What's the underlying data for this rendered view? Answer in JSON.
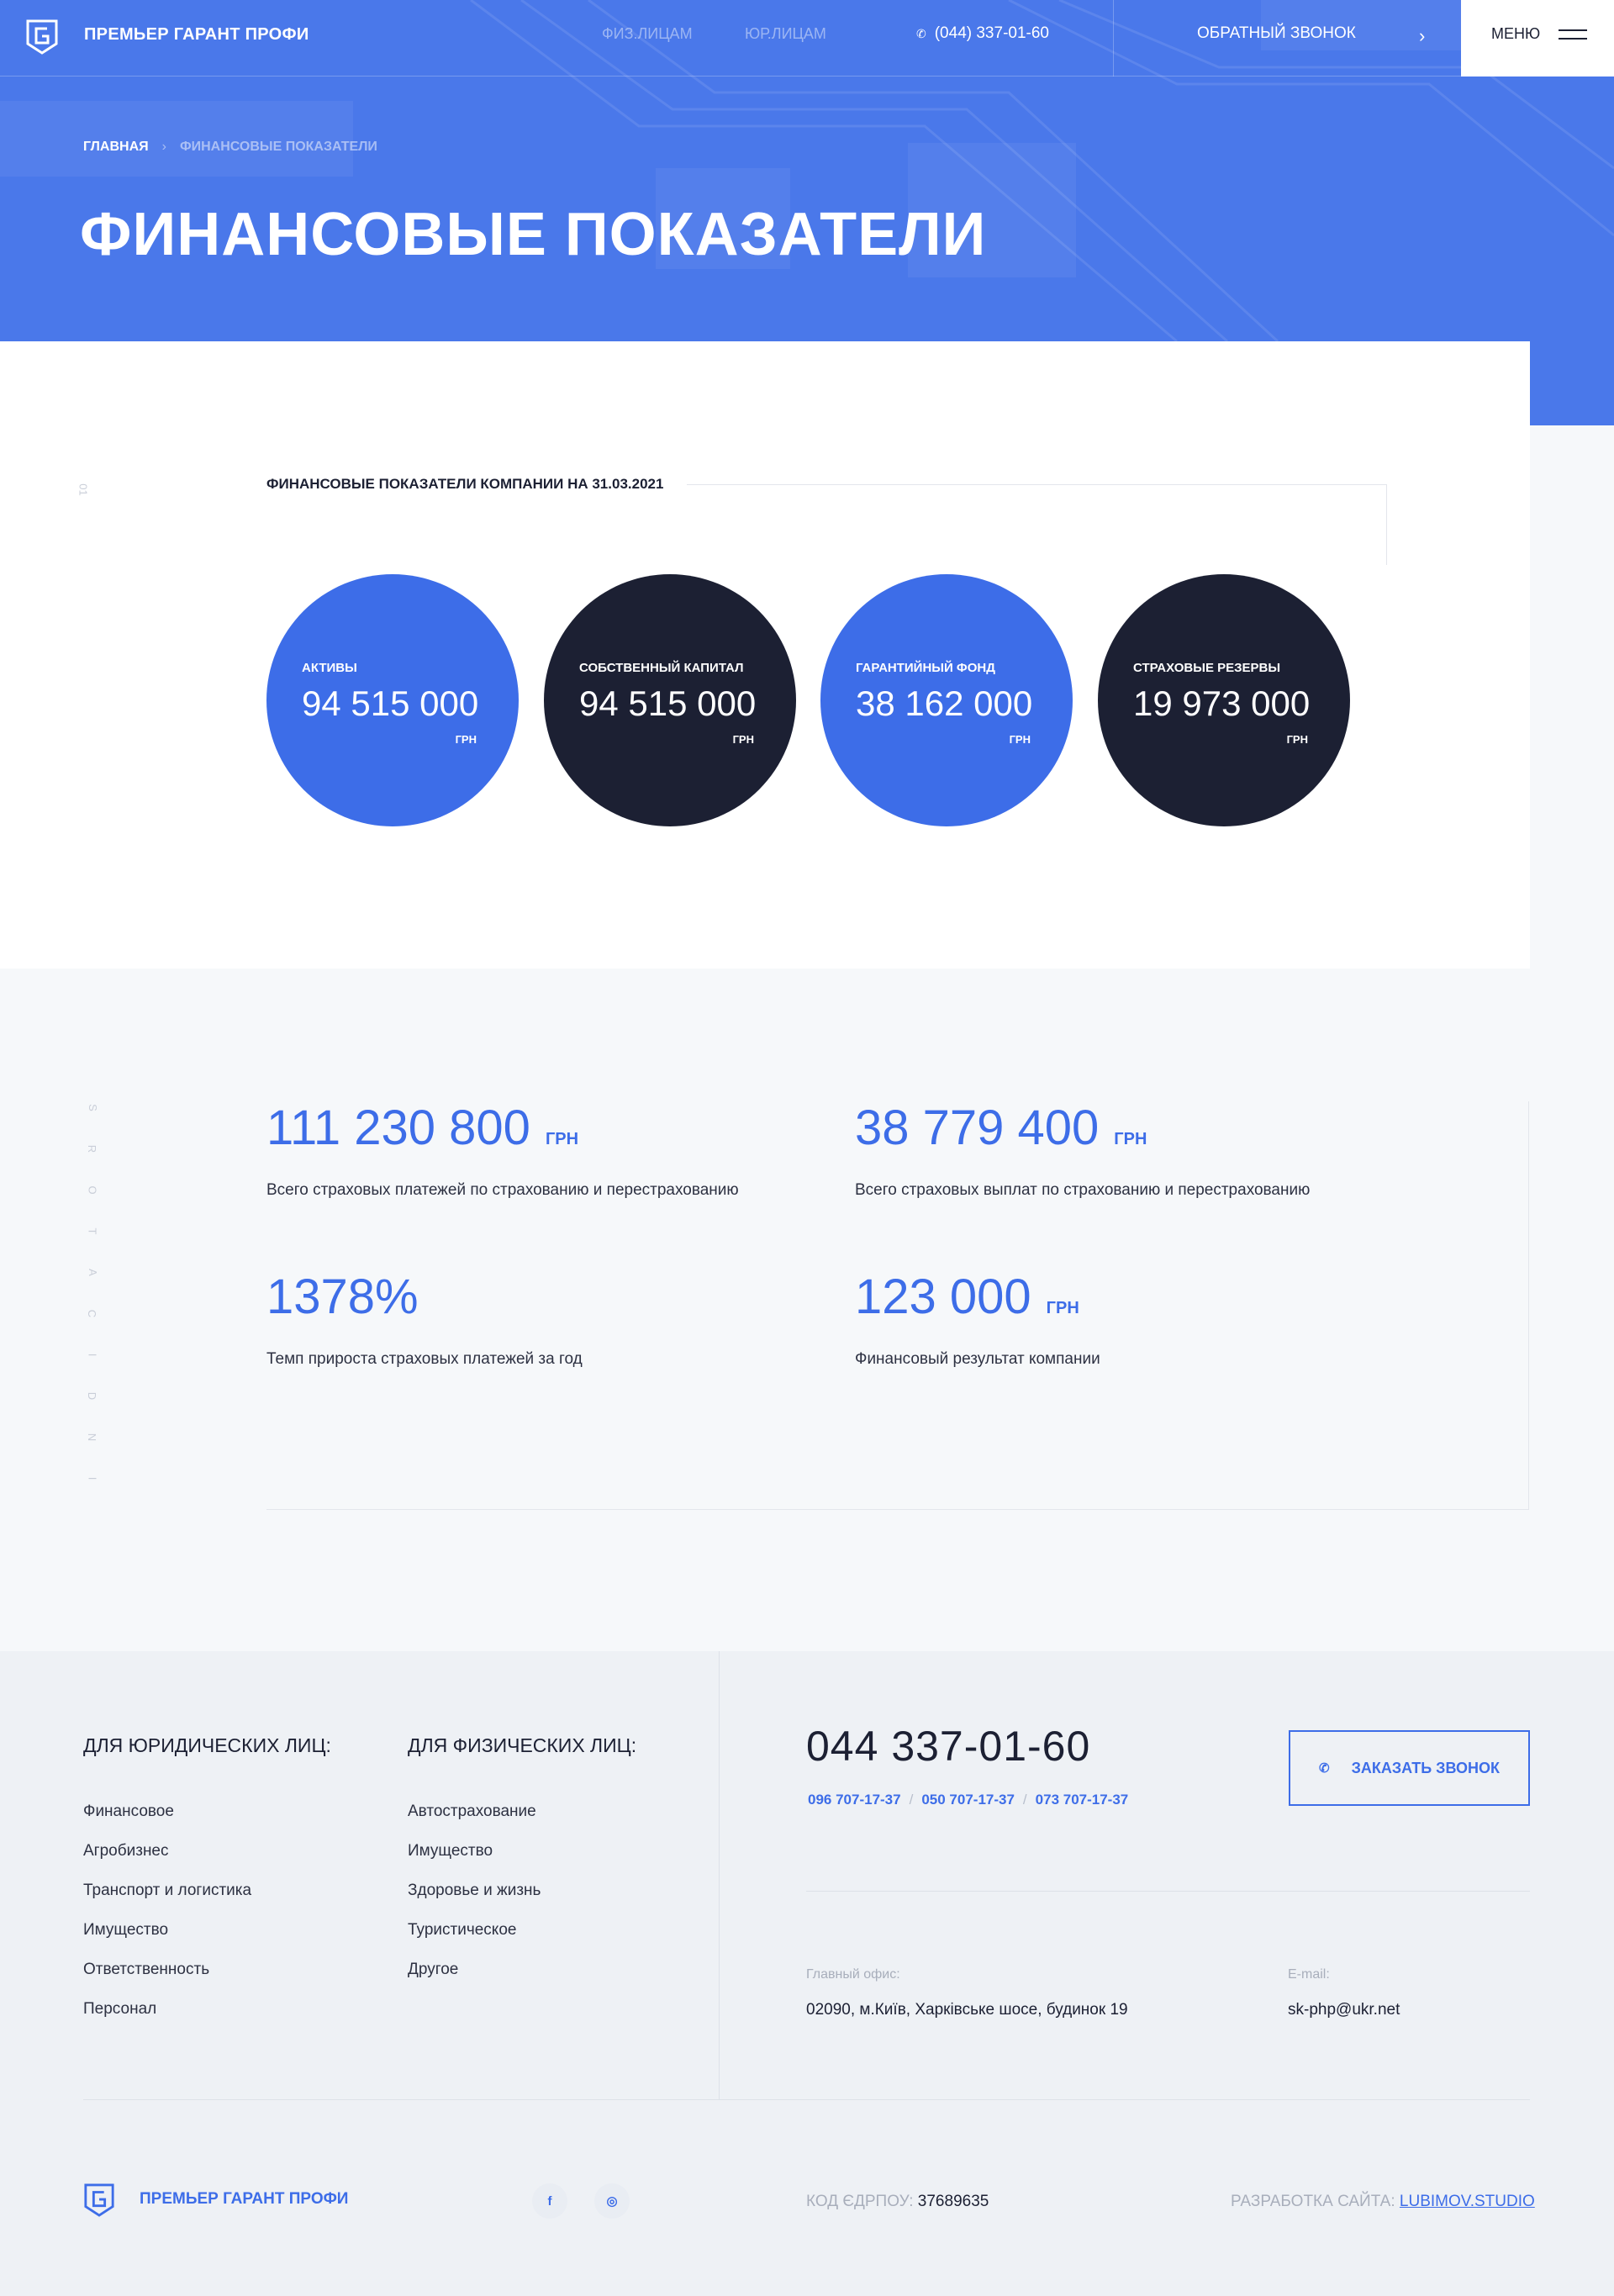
{
  "header": {
    "brand": "ПРЕМЬЕР ГАРАНТ ПРОФИ",
    "nav": [
      "ФИЗ.ЛИЦАМ",
      "ЮР.ЛИЦАМ"
    ],
    "phone": "(044) 337-01-60",
    "callback": "ОБРАТНЫЙ ЗВОНОК",
    "menu": "МЕНЮ"
  },
  "breadcrumbs": {
    "home": "ГЛАВНАЯ",
    "current": "ФИНАНСОВЫЕ ПОКАЗАТЕЛИ"
  },
  "page_title": "ФИНАНСОВЫЕ ПОКАЗАТЕЛИ",
  "section1": {
    "number": "01",
    "title": "ФИНАНСОВЫЕ ПОКАЗАТЕЛИ КОМПАНИИ НА 31.03.2021",
    "circles": [
      {
        "label": "АКТИВЫ",
        "value": "94 515 000",
        "unit": "ГРН"
      },
      {
        "label": "СОБСТВЕННЫЙ КАПИТАЛ",
        "value": "94 515 000",
        "unit": "ГРН"
      },
      {
        "label": "ГАРАНТИЙНЫЙ ФОНД",
        "value": "38 162 000",
        "unit": "ГРН"
      },
      {
        "label": "СТРАХОВЫЕ РЕЗЕРВЫ",
        "value": "19 973 000",
        "unit": "ГРН"
      }
    ]
  },
  "section2": {
    "vertical_label": [
      "I",
      "N",
      "D",
      "I",
      "C",
      "A",
      "T",
      "O",
      "R",
      "S"
    ],
    "stats": [
      {
        "value": "111 230 800",
        "unit": "ГРН",
        "desc": "Всего страховых платежей по страхованию и перестрахованию"
      },
      {
        "value": "38 779 400",
        "unit": "ГРН",
        "desc": "Всего страховых выплат по страхованию и перестрахованию"
      },
      {
        "value": "1378%",
        "unit": "",
        "desc": "Темп прироста страховых платежей за год"
      },
      {
        "value": "123 000",
        "unit": "ГРН",
        "desc": "Финансовый результат компании"
      }
    ]
  },
  "footer": {
    "legal_heading": "ДЛЯ ЮРИДИЧЕСКИХ ЛИЦ:",
    "legal_items": [
      "Финансовое",
      "Агробизнес",
      "Транспорт и логистика",
      "Имущество",
      "Ответственность",
      "Персонал"
    ],
    "personal_heading": "ДЛЯ ФИЗИЧЕСКИХ ЛИЦ:",
    "personal_items": [
      "Автострахование",
      "Имущество",
      "Здоровье и жизнь",
      "Туристическое",
      "Другое"
    ],
    "main_phone": "044 337-01-60",
    "extra_phones": [
      "096 707-17-37",
      "050 707-17-37",
      "073 707-17-37"
    ],
    "order_button": "ЗАКАЗАТЬ ЗВОНОК",
    "office_label": "Главный офис:",
    "office_address": "02090, м.Київ, Харківське шосе, будинок 19",
    "email_label": "E-mail:",
    "email": "sk-php@ukr.net",
    "brand": "ПРЕМЬЕР ГАРАНТ ПРОФИ",
    "social": [
      "f",
      "◎"
    ],
    "edrpou_label": "КОД ЄДРПОУ:",
    "edrpou_value": "37689635",
    "dev_label": "РАЗРАБОТКА САЙТА:",
    "dev_link": "LUBIMOV.STUDIO"
  },
  "colors": {
    "accent": "#3d6de8",
    "hero": "#4a78ea",
    "dark": "#1c2033"
  }
}
